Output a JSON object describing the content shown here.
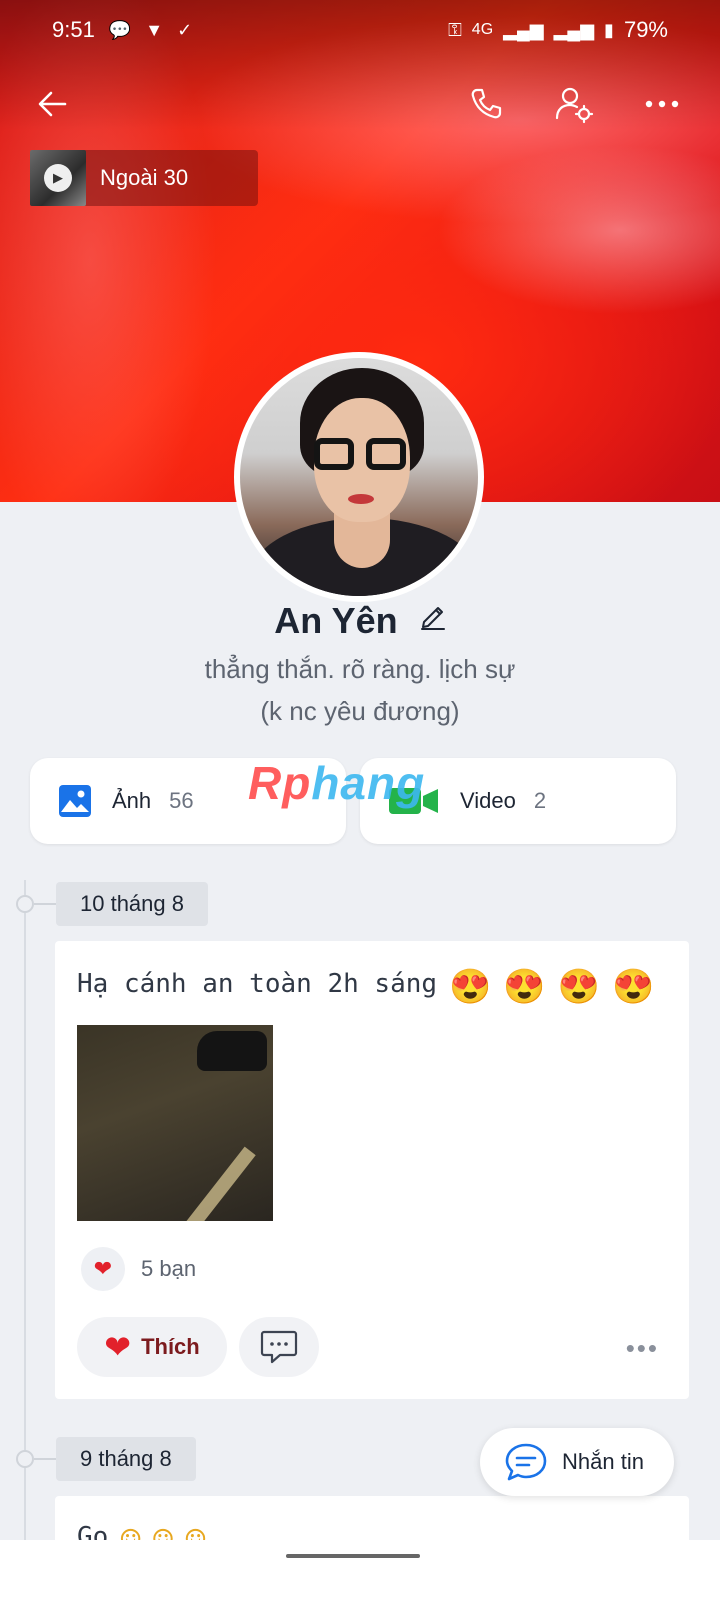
{
  "status_bar": {
    "time": "9:51",
    "network": "4G",
    "battery": "79%",
    "icons": [
      "messenger-icon",
      "shield-icon",
      "check-icon",
      "key-icon",
      "signal-icon",
      "battery-icon"
    ]
  },
  "top_bar": {
    "icons": [
      "back-arrow-icon",
      "phone-icon",
      "user-settings-icon",
      "more-icon"
    ]
  },
  "music": {
    "title": "Ngoài 30"
  },
  "profile": {
    "name": "An Yên",
    "bio_line1": "thẳng thắn. rõ ràng. lịch sự",
    "bio_line2": "(k nc yêu đương)"
  },
  "media": {
    "photos_label": "Ảnh",
    "photos_count": "56",
    "videos_label": "Video",
    "videos_count": "2"
  },
  "watermark": {
    "text_a": "Rp",
    "text_b": "hang"
  },
  "timeline": [
    {
      "date": "10 tháng 8",
      "text": "Hạ cánh an toàn 2h sáng",
      "emojis": [
        "😍",
        "😍",
        "😍",
        "😍"
      ],
      "reaction_count": "5 bạn",
      "like_label": "Thích"
    },
    {
      "date": "9 tháng 8",
      "text": "Go",
      "emojis": [
        "☺",
        "☺",
        "☺"
      ]
    }
  ],
  "fab": {
    "label": "Nhắn tin"
  },
  "colors": {
    "accent_blue": "#1a73e8",
    "like_red": "#e2212b",
    "video_green": "#24b34a"
  }
}
